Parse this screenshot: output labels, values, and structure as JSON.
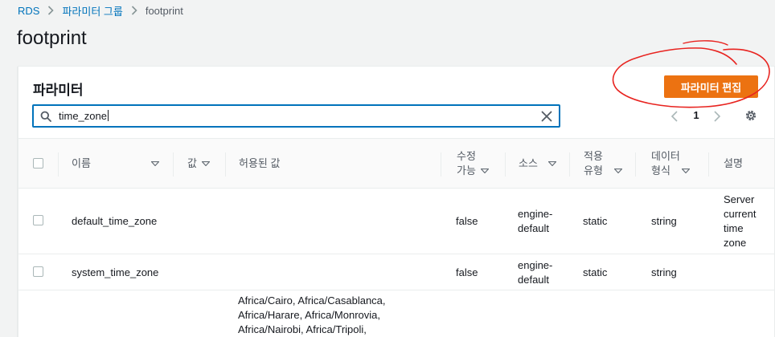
{
  "breadcrumb": {
    "items": [
      "RDS",
      "파라미터 그룹",
      "footprint"
    ]
  },
  "page": {
    "title": "footprint"
  },
  "panel": {
    "title": "파라미터",
    "edit_button": "파라미터 편집"
  },
  "search": {
    "value": "time_zone"
  },
  "pagination": {
    "current_page": "1"
  },
  "table": {
    "columns": {
      "name": "이름",
      "value": "값",
      "allowed": "허용된 값",
      "modifiable_1": "수정",
      "modifiable_2": "가능",
      "source": "소스",
      "apply_1": "적용",
      "apply_2": "유형",
      "data_1": "데이터",
      "data_2": "형식",
      "desc": "설명"
    },
    "rows": [
      {
        "name": "default_time_zone",
        "value": "",
        "allowed": "",
        "modifiable": "false",
        "source_1": "engine-",
        "source_2": "default",
        "apply_type": "static",
        "data_type": "string",
        "desc_1": "Server",
        "desc_2": "current",
        "desc_3": "time",
        "desc_4": "zone"
      },
      {
        "name": "system_time_zone",
        "value": "",
        "allowed": "",
        "modifiable": "false",
        "source_1": "engine-",
        "source_2": "default",
        "apply_type": "static",
        "data_type": "string",
        "desc_1": "",
        "desc_2": "",
        "desc_3": "",
        "desc_4": ""
      },
      {
        "name": "",
        "allowed_1": "Africa/Cairo, Africa/Casablanca,",
        "allowed_2": "Africa/Harare, Africa/Monrovia,",
        "allowed_3": "Africa/Nairobi, Africa/Tripoli,"
      }
    ]
  },
  "colors": {
    "primary_button": "#ec7211",
    "link": "#0073bb",
    "focus_border": "#0073bb",
    "annotation": "#e8231f"
  }
}
